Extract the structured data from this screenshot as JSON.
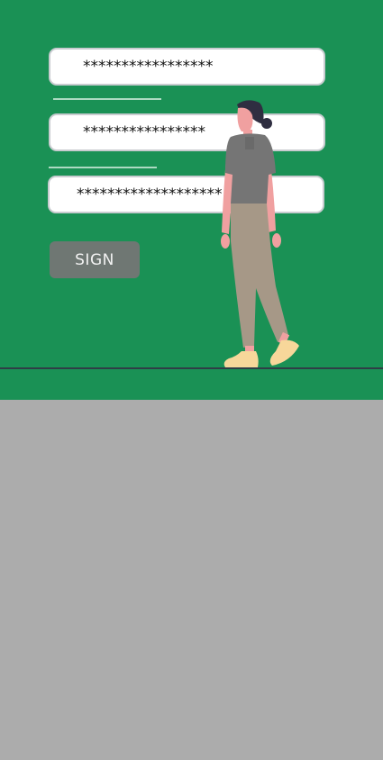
{
  "form": {
    "field1_value": "*****************",
    "field2_value": "****************",
    "field3_value": "*******************",
    "sign_label": "SIGN"
  },
  "colors": {
    "panel_green": "#1a9155",
    "background_gray": "#acacac",
    "button_gray": "#6f7773"
  },
  "illustration": {
    "icon": "walking-woman-illustration"
  }
}
